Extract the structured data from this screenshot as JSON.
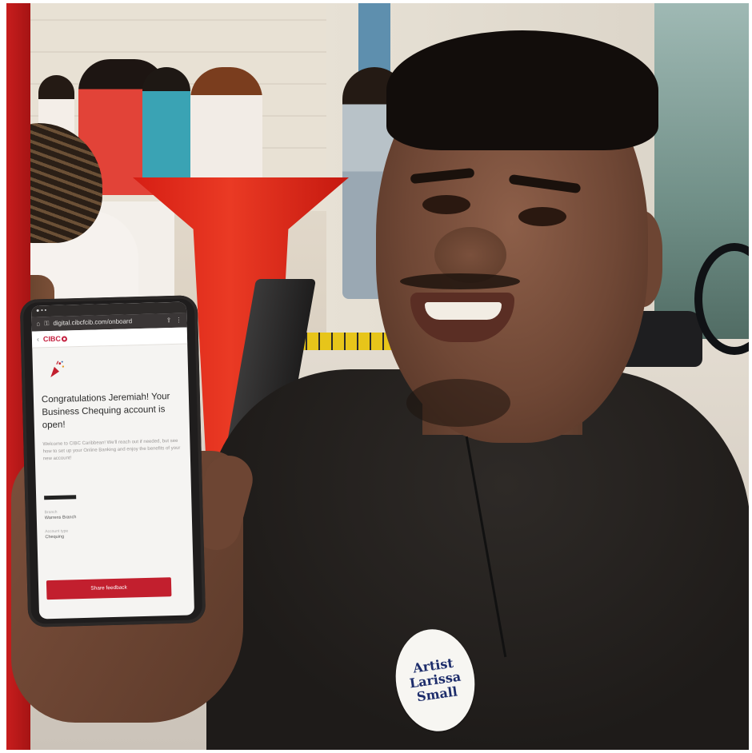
{
  "phone_screen": {
    "url": "digital.cibcfcib.com/onboard",
    "bank_logo": "CIBC",
    "headline": "Congratulations Jeremiah! Your Business Chequing account is open!",
    "body": "Welcome to CIBC Caribbean! We'll reach out if needed, but see how to set up your Online Banking and enjoy the benefits of your new account!",
    "details": [
      {
        "label": "Branch",
        "value": "Warrens Branch"
      },
      {
        "label": "Account type",
        "value": "Chequing"
      }
    ],
    "button_label": "Share feedback"
  },
  "badge": {
    "lines": [
      "Artist",
      "Larissa",
      "Small"
    ]
  },
  "colors": {
    "brand_red": "#c21f2e",
    "badge_text": "#1d2d6b"
  },
  "icons": [
    "home-icon",
    "lock-icon",
    "share-icon",
    "back-icon",
    "party-popper-icon"
  ]
}
